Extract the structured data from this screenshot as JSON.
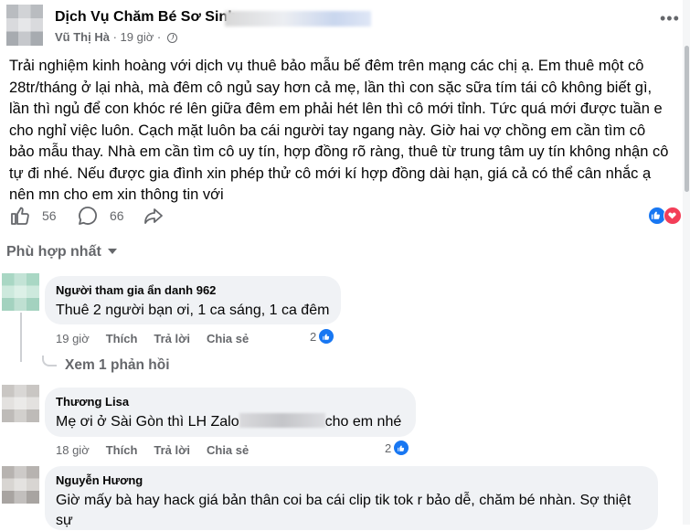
{
  "post": {
    "group_name": "Dịch Vụ Chăm Bé Sơ Sinh",
    "author": "Vũ Thị Hà",
    "separator": "·",
    "time": "19 giờ",
    "more_icon": "ellipsis-icon",
    "text": "Trải nghiệm kinh hoàng với dịch vụ thuê bảo mẫu bế đêm trên mạng các chị ạ. Em thuê một cô 28tr/tháng ở lại nhà, mà đêm cô ngủ say hơn cả mẹ, lần thì con sặc sữa tím tái cô không biết gì, lần thì ngủ để con khóc ré lên giữa đêm em phải hét lên thì cô mới tỉnh. Tức quá mới được tuần e cho nghỉ việc luôn. Cạch mặt luôn ba cái người tay ngang này. Giờ hai vợ chồng em cần tìm cô bảo mẫu thay. Nhà em cần tìm cô uy tín, hợp đồng rõ ràng, thuê từ trung tâm uy tín không nhận cô tự đi nhé. Nếu được gia đình xin phép thử cô mới kí hợp đồng dài hạn, giá cả có thể cân nhắc ạ nên mn cho em xin thông tin với",
    "like_count": "56",
    "comment_count": "66",
    "reaction_icons": [
      "like-icon",
      "love-icon"
    ]
  },
  "sort": {
    "label": "Phù hợp nhất"
  },
  "comments": [
    {
      "name": "Người tham gia ẩn danh 962",
      "text": "Thuê 2 người bạn ơi, 1 ca sáng, 1 ca đêm",
      "time": "19 giờ",
      "like_label": "Thích",
      "reply_label": "Trả lời",
      "share_label": "Chia sẻ",
      "reaction_count": "2",
      "view_replies": "Xem 1 phản hồi"
    },
    {
      "name": "Thương Lisa",
      "text_before": "Mẹ ơi ở Sài Gòn thì LH Zalo",
      "text_after": "cho em nhé",
      "time": "18 giờ",
      "like_label": "Thích",
      "reply_label": "Trả lời",
      "share_label": "Chia sẻ",
      "reaction_count": "2"
    },
    {
      "name": "Nguyễn Hương",
      "text": "Giờ mấy bà hay hack giá bản thân coi ba cái clip tik tok r bảo dễ, chăm bé nhàn. Sợ thiệt sự"
    }
  ],
  "colors": {
    "accent": "#1877f2",
    "love": "#f33e58",
    "muted": "#65676b",
    "bubble": "#f0f2f5"
  }
}
